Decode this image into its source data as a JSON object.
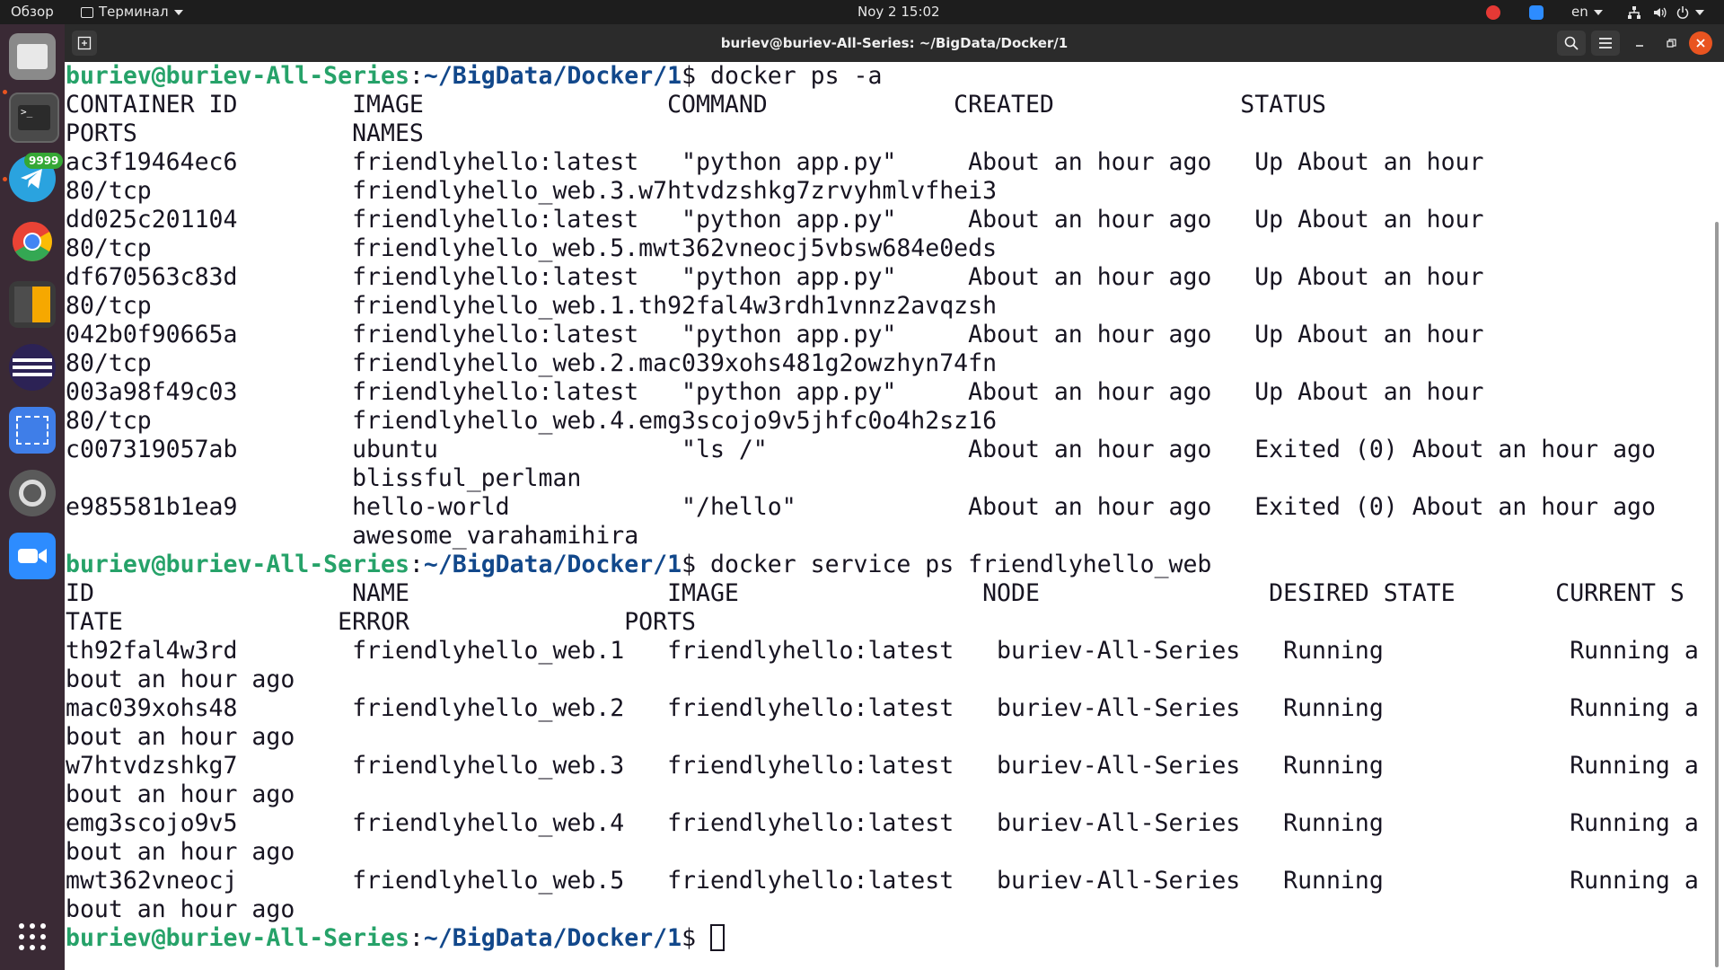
{
  "topbar": {
    "activities": "Обзор",
    "app_name": "Терминал",
    "datetime": "Noy 2  15:02",
    "lang": "en"
  },
  "dock": {
    "telegram_badge": "9999",
    "items": [
      {
        "name": "files-icon",
        "color": "#8a8a8a"
      },
      {
        "name": "terminal-icon",
        "color": "#3b3b3b"
      },
      {
        "name": "telegram-icon",
        "color": "#2aa3df"
      },
      {
        "name": "chrome-icon",
        "color": "#ea4335"
      },
      {
        "name": "calculator-icon",
        "color": "#f6a800"
      },
      {
        "name": "eclipse-icon",
        "color": "#2c2255"
      },
      {
        "name": "screenshot-icon",
        "color": "#3f7ee8"
      },
      {
        "name": "settings-icon",
        "color": "#5a5a5a"
      },
      {
        "name": "zoom-icon",
        "color": "#2d8cff"
      }
    ]
  },
  "window": {
    "title": "buriev@buriev-All-Series: ~/BigData/Docker/1"
  },
  "terminal": {
    "prompt_user": "buriev@buriev-All-Series",
    "prompt_path": "~/BigData/Docker/1",
    "prompt_symbol": "$",
    "cmd1": " docker ps -a",
    "ps_lines": [
      "CONTAINER ID        IMAGE                 COMMAND             CREATED             STATUS",
      "PORTS               NAMES",
      "ac3f19464ec6        friendlyhello:latest   \"python app.py\"     About an hour ago   Up About an hour",
      "80/tcp              friendlyhello_web.3.w7htvdzshkg7zrvyhmlvfhei3",
      "dd025c201104        friendlyhello:latest   \"python app.py\"     About an hour ago   Up About an hour",
      "80/tcp              friendlyhello_web.5.mwt362vneocj5vbsw684e0eds",
      "df670563c83d        friendlyhello:latest   \"python app.py\"     About an hour ago   Up About an hour",
      "80/tcp              friendlyhello_web.1.th92fal4w3rdh1vnnz2avqzsh",
      "042b0f90665a        friendlyhello:latest   \"python app.py\"     About an hour ago   Up About an hour",
      "80/tcp              friendlyhello_web.2.mac039xohs481g2owzhyn74fn",
      "003a98f49c03        friendlyhello:latest   \"python app.py\"     About an hour ago   Up About an hour",
      "80/tcp              friendlyhello_web.4.emg3scojo9v5jhfc0o4h2sz16",
      "c007319057ab        ubuntu                 \"ls /\"              About an hour ago   Exited (0) About an hour ago",
      "                    blissful_perlman",
      "e985581b1ea9        hello-world            \"/hello\"            About an hour ago   Exited (0) About an hour ago",
      "                    awesome_varahamihira"
    ],
    "cmd2": " docker service ps friendlyhello_web",
    "service_lines": [
      "ID                  NAME                  IMAGE                 NODE                DESIRED STATE       CURRENT S",
      "TATE               ERROR               PORTS",
      "th92fal4w3rd        friendlyhello_web.1   friendlyhello:latest   buriev-All-Series   Running             Running a",
      "bout an hour ago",
      "mac039xohs48        friendlyhello_web.2   friendlyhello:latest   buriev-All-Series   Running             Running a",
      "bout an hour ago",
      "w7htvdzshkg7        friendlyhello_web.3   friendlyhello:latest   buriev-All-Series   Running             Running a",
      "bout an hour ago",
      "emg3scojo9v5        friendlyhello_web.4   friendlyhello:latest   buriev-All-Series   Running             Running a",
      "bout an hour ago",
      "mwt362vneocj        friendlyhello_web.5   friendlyhello:latest   buriev-All-Series   Running             Running a",
      "bout an hour ago"
    ]
  }
}
